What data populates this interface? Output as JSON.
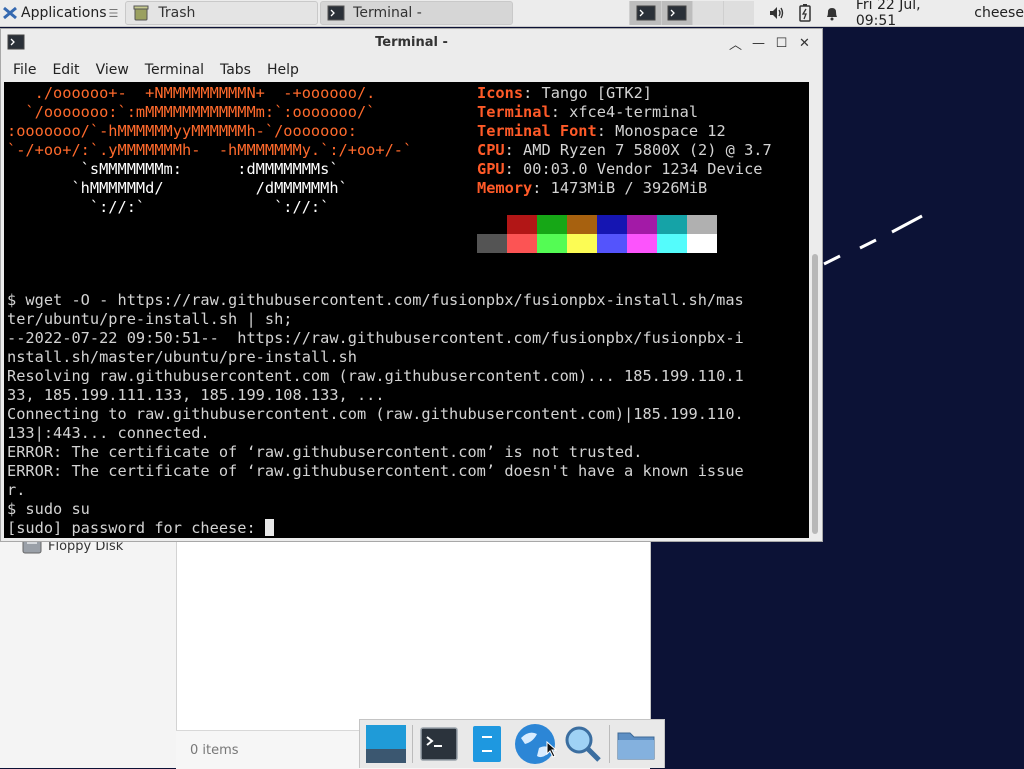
{
  "top_panel": {
    "applications_label": "Applications",
    "tasks": [
      {
        "label": "Trash",
        "icon": "trash-icon"
      },
      {
        "label": "Terminal -",
        "icon": "terminal-icon"
      }
    ],
    "clock": "Fri 22 Jul, 09:51",
    "user": "cheese"
  },
  "file_manager": {
    "sidebar_item": "Floppy Disk",
    "status": "0 items"
  },
  "terminal": {
    "title": "Terminal -",
    "menu": [
      "File",
      "Edit",
      "View",
      "Terminal",
      "Tabs",
      "Help"
    ],
    "ascii_art": [
      "   ./oooooo+-  +NMMMMMMMMMN+  -+oooooo/.",
      "  `/ooooooo:`:mMMMMMMMMMMMMm:`:ooooooo/`",
      ":ooooooo/`-hMMMMMMyyMMMMMMh-`/ooooooo:",
      "`-/+oo+/:`.yMMMMMMMh-  -hMMMMMMMy.`:/+oo+/-`",
      "        `sMMMMMMMm:      :dMMMMMMMs`",
      "       `hMMMMMMd/          /dMMMMMMh`",
      "         `://:`              `://:`"
    ],
    "info": [
      {
        "key": "Icons",
        "value": ": Tango [GTK2]"
      },
      {
        "key": "Terminal",
        "value": ": xfce4-terminal"
      },
      {
        "key": "Terminal Font",
        "value": ": Monospace 12"
      },
      {
        "key": "CPU",
        "value": ": AMD Ryzen 7 5800X (2) @ 3.7"
      },
      {
        "key": "GPU",
        "value": ": 00:03.0 Vendor 1234 Device"
      },
      {
        "key": "Memory",
        "value": ": 1473MiB / 3926MiB"
      }
    ],
    "palette_top": [
      "#000000",
      "#b21616",
      "#16a716",
      "#a7610f",
      "#1515b2",
      "#a31aa7",
      "#15a3a7",
      "#b0b0b0"
    ],
    "palette_bottom": [
      "#545454",
      "#fc5454",
      "#54fc54",
      "#fcfc54",
      "#5454fc",
      "#fc54fc",
      "#54fcfc",
      "#ffffff"
    ],
    "output": [
      "$ wget -O - https://raw.githubusercontent.com/fusionpbx/fusionpbx-install.sh/mas",
      "ter/ubuntu/pre-install.sh | sh;",
      "--2022-07-22 09:50:51--  https://raw.githubusercontent.com/fusionpbx/fusionpbx-i",
      "nstall.sh/master/ubuntu/pre-install.sh",
      "Resolving raw.githubusercontent.com (raw.githubusercontent.com)... 185.199.110.1",
      "33, 185.199.111.133, 185.199.108.133, ...",
      "Connecting to raw.githubusercontent.com (raw.githubusercontent.com)|185.199.110.",
      "133|:443... connected.",
      "ERROR: The certificate of ‘raw.githubusercontent.com’ is not trusted.",
      "ERROR: The certificate of ‘raw.githubusercontent.com’ doesn't have a known issue",
      "r.",
      "$ sudo su"
    ],
    "prompt": "[sudo] password for cheese: "
  },
  "dock": {
    "items": [
      "show-desktop-icon",
      "terminal-icon",
      "file-manager-icon",
      "web-browser-icon",
      "app-finder-icon",
      "folder-icon"
    ]
  }
}
